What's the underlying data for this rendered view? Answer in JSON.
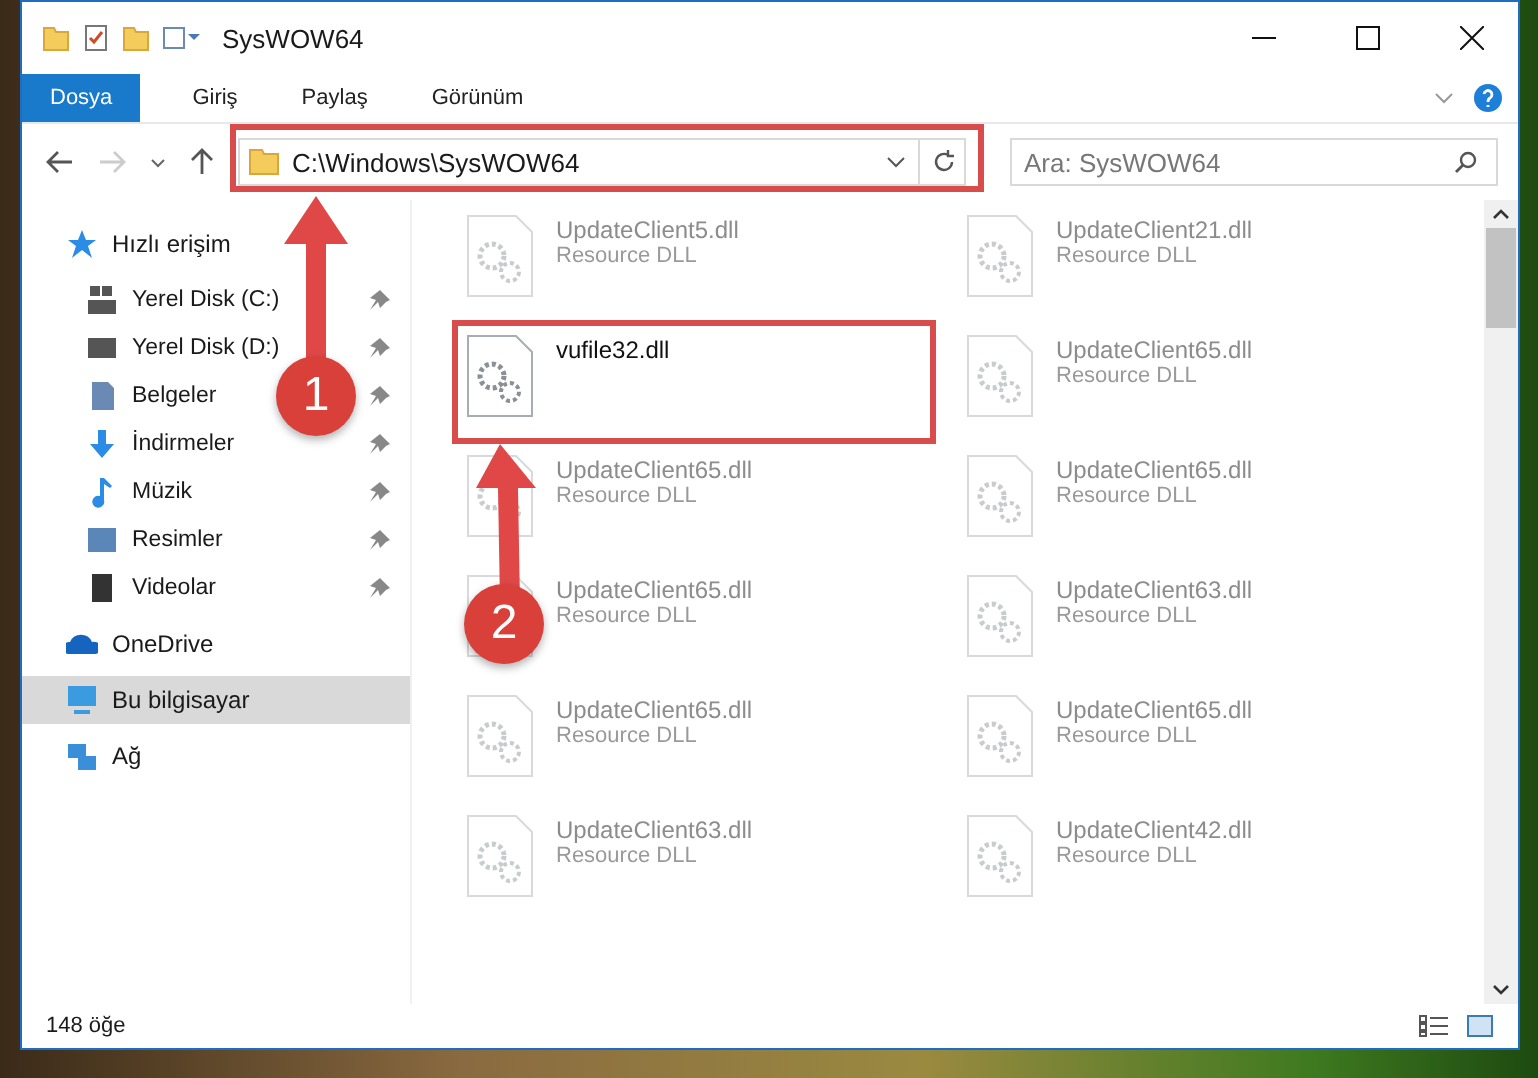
{
  "window": {
    "title": "SysWOW64"
  },
  "ribbon_tabs": [
    {
      "label": "Dosya",
      "selected": true
    },
    {
      "label": "Giriş",
      "selected": false
    },
    {
      "label": "Paylaş",
      "selected": false
    },
    {
      "label": "Görünüm",
      "selected": false
    }
  ],
  "address_bar": {
    "path": "C:\\Windows\\SysWOW64"
  },
  "search": {
    "placeholder": "Ara: SysWOW64"
  },
  "sidebar": {
    "items": [
      {
        "label": "Hızlı erişim",
        "kind": "star",
        "selected": false,
        "children": [
          {
            "label": "Yerel Disk (C:)",
            "kind": "windisk",
            "selected": false
          },
          {
            "label": "Yerel Disk (D:)",
            "kind": "disk",
            "selected": false
          },
          {
            "label": "Belgeler",
            "kind": "docs",
            "selected": false
          },
          {
            "label": "İndirmeler",
            "kind": "download",
            "selected": false
          },
          {
            "label": "Müzik",
            "kind": "music",
            "selected": false
          },
          {
            "label": "Resimler",
            "kind": "pictures",
            "selected": false
          },
          {
            "label": "Videolar",
            "kind": "video",
            "selected": false
          }
        ]
      },
      {
        "label": "OneDrive",
        "kind": "cloud",
        "selected": false
      },
      {
        "label": "Bu bilgisayar",
        "kind": "pc",
        "selected": true
      },
      {
        "label": "Ağ",
        "kind": "network",
        "selected": false
      }
    ]
  },
  "files": [
    {
      "name": "UpdateClient5.dll",
      "type": "Resource DLL",
      "faded": true
    },
    {
      "name": "UpdateClient21.dll",
      "type": "Resource DLL",
      "faded": true
    },
    {
      "name": "vufile32.dll",
      "faded": false
    },
    {
      "name": "UpdateClient65.dll",
      "type": "Resource DLL",
      "faded": true
    },
    {
      "name": "UpdateClient65.dll",
      "type": "Resource DLL",
      "faded": true
    },
    {
      "name": "UpdateClient65.dll",
      "type": "Resource DLL",
      "faded": true
    },
    {
      "name": "UpdateClient65.dll",
      "type": "Resource DLL",
      "faded": true
    },
    {
      "name": "UpdateClient63.dll",
      "type": "Resource DLL",
      "faded": true
    },
    {
      "name": "UpdateClient65.dll",
      "type": "Resource DLL",
      "faded": true
    },
    {
      "name": "UpdateClient65.dll",
      "type": "Resource DLL",
      "faded": true
    },
    {
      "name": "UpdateClient63.dll",
      "type": "Resource DLL",
      "faded": true
    },
    {
      "name": "UpdateClient42.dll",
      "type": "Resource DLL",
      "faded": true
    }
  ],
  "annotations": [
    {
      "number": "1"
    },
    {
      "number": "2"
    }
  ],
  "status_bar": {
    "count": "148 öğe"
  }
}
